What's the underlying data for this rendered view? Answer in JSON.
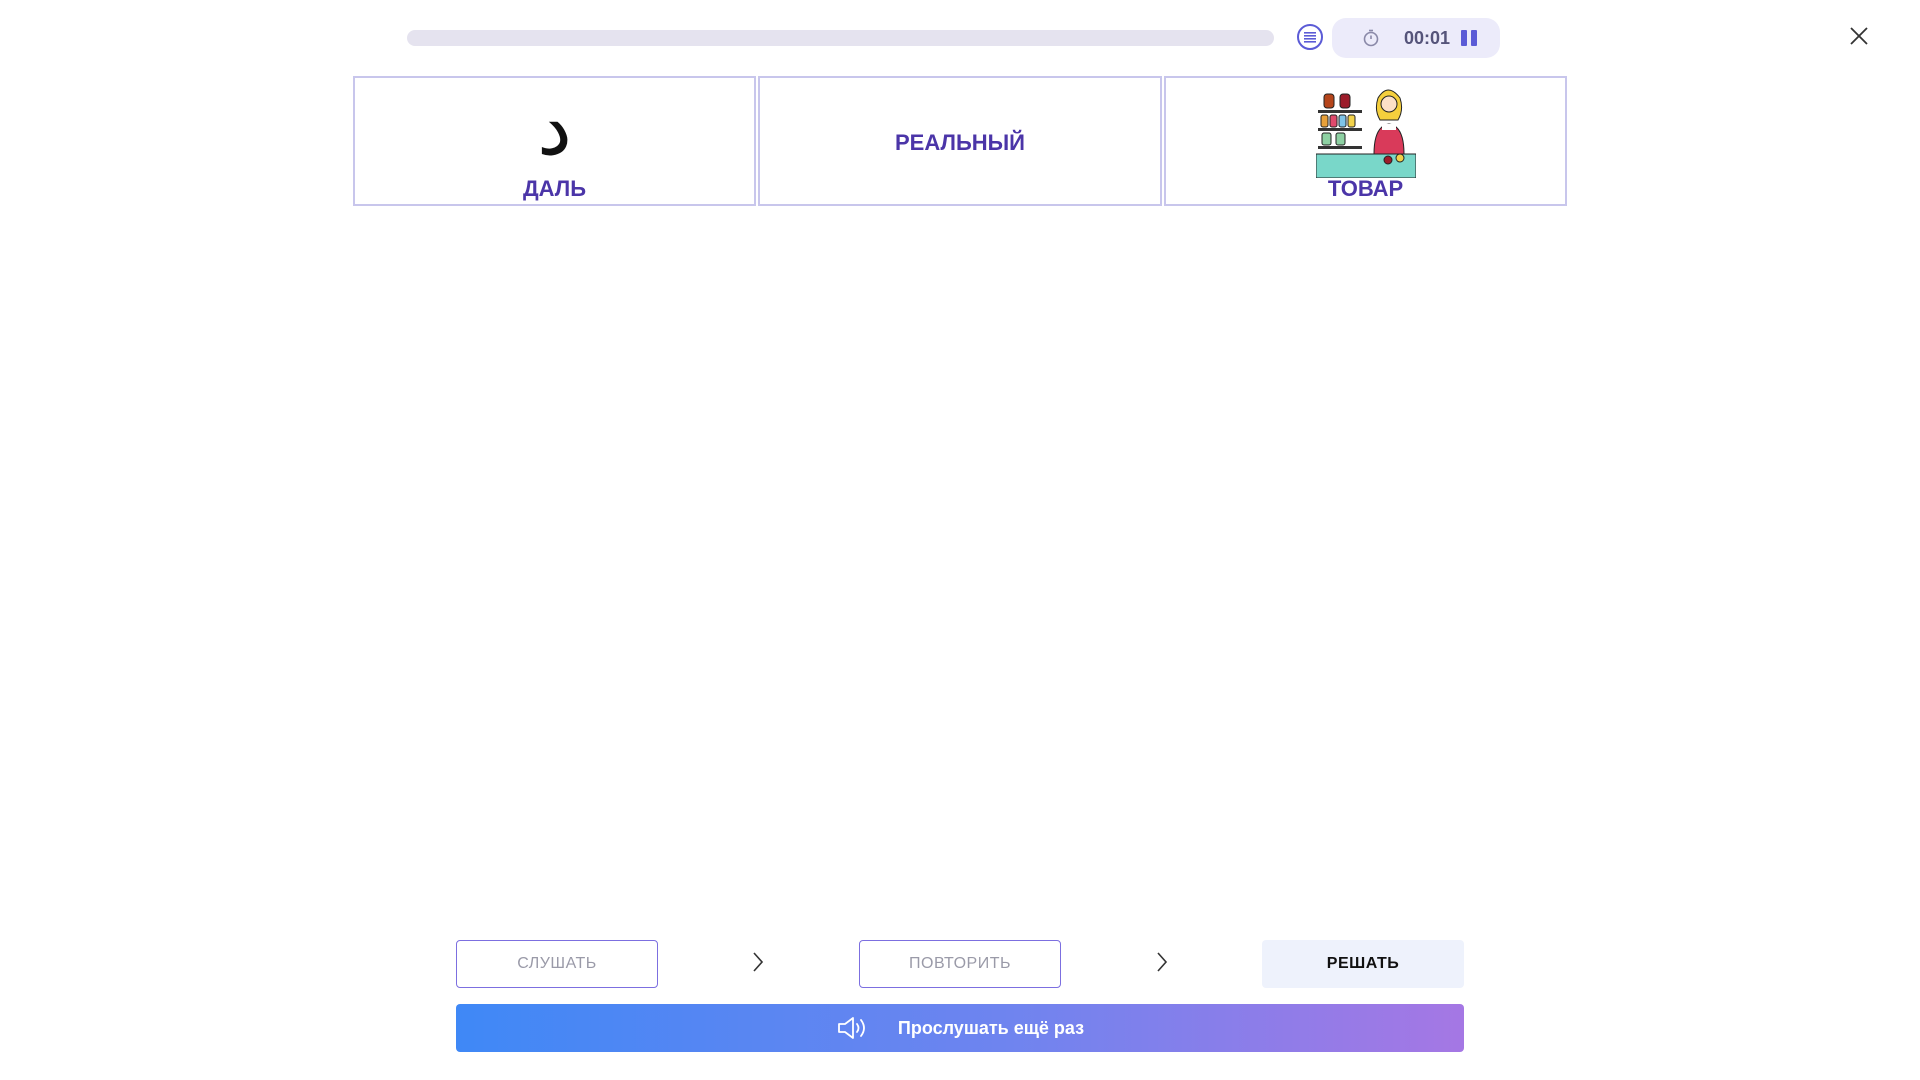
{
  "header": {
    "progress": 0,
    "timer": "00:01",
    "icons": {
      "list": "list-icon",
      "stopwatch": "stopwatch-icon",
      "pause": "pause-icon",
      "close": "close-icon"
    }
  },
  "cards": [
    {
      "glyph": "د",
      "label": "ДАЛЬ"
    },
    {
      "label": "РЕАЛЬНЫЙ"
    },
    {
      "image": "shopkeeper-illustration",
      "label": "ТОВАР"
    }
  ],
  "steps": [
    {
      "label": "СЛУШАТЬ"
    },
    {
      "label": "ПОВТОРИТЬ"
    },
    {
      "label": "РЕШАТЬ"
    }
  ],
  "listen_again": {
    "label": "Прослушать ещё раз",
    "icon": "speaker-icon"
  },
  "colors": {
    "accent": "#4b35a8",
    "card_border": "#c8c6ec",
    "gradient_start": "#3f88f6",
    "gradient_end": "#a577e4"
  }
}
